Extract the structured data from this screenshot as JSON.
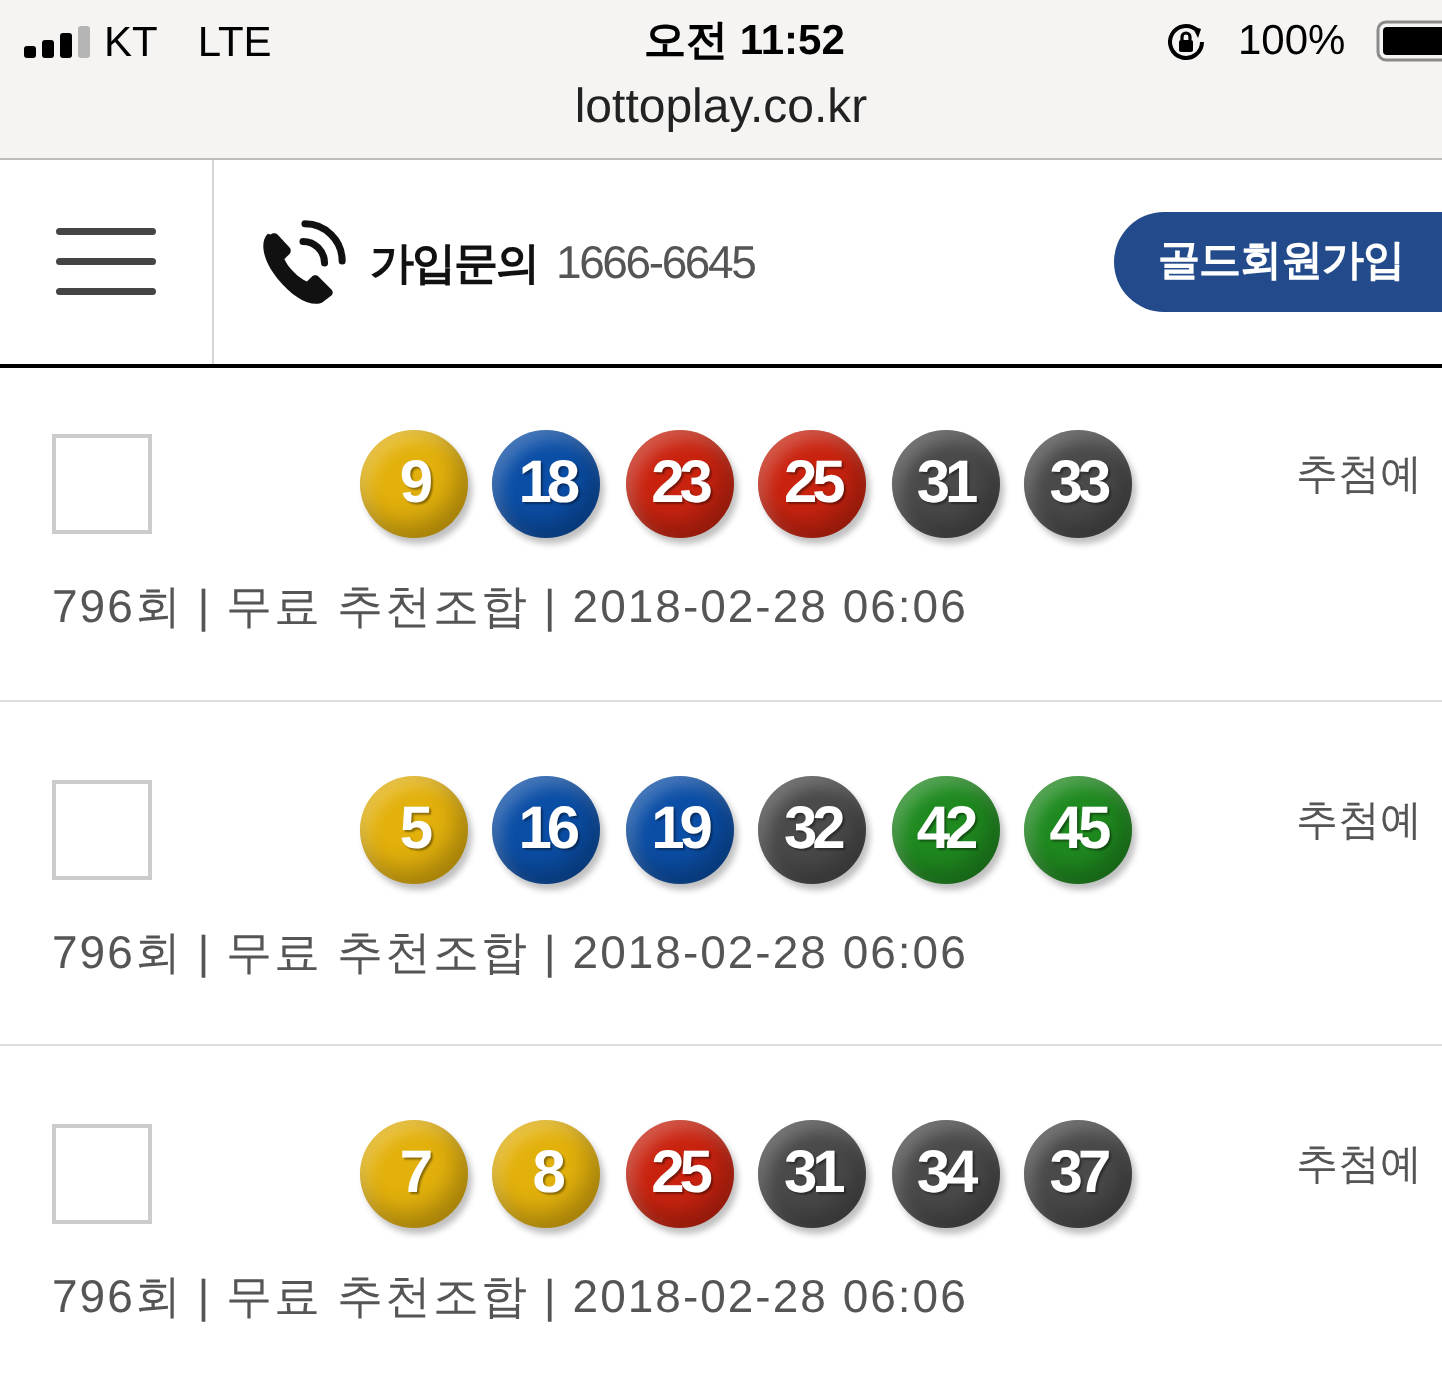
{
  "status_bar": {
    "carrier": "KT",
    "network": "LTE",
    "time": "오전 11:52",
    "battery": "100%"
  },
  "address_bar": {
    "url": "lottoplay.co.kr"
  },
  "header": {
    "contact_label": "가입문의",
    "contact_phone": "1666-6645",
    "join_button": "골드회원가입"
  },
  "entries": [
    {
      "checked": false,
      "balls": [
        {
          "number": "9",
          "color": "#e3b10c"
        },
        {
          "number": "18",
          "color": "#0b4ea6"
        },
        {
          "number": "23",
          "color": "#c9230f"
        },
        {
          "number": "25",
          "color": "#c9230f"
        },
        {
          "number": "31",
          "color": "#4a4a4a"
        },
        {
          "number": "33",
          "color": "#4a4a4a"
        }
      ],
      "status": "추첨예",
      "meta": "796회 | 무료 추천조합 | 2018-02-28 06:06"
    },
    {
      "checked": false,
      "balls": [
        {
          "number": "5",
          "color": "#e3b10c"
        },
        {
          "number": "16",
          "color": "#0b4ea6"
        },
        {
          "number": "19",
          "color": "#0b4ea6"
        },
        {
          "number": "32",
          "color": "#4a4a4a"
        },
        {
          "number": "42",
          "color": "#1f8a1f"
        },
        {
          "number": "45",
          "color": "#1f8a1f"
        }
      ],
      "status": "추첨예",
      "meta": "796회 | 무료 추천조합 | 2018-02-28 06:06"
    },
    {
      "checked": false,
      "balls": [
        {
          "number": "7",
          "color": "#e3b10c"
        },
        {
          "number": "8",
          "color": "#e3b10c"
        },
        {
          "number": "25",
          "color": "#c9230f"
        },
        {
          "number": "31",
          "color": "#4a4a4a"
        },
        {
          "number": "34",
          "color": "#4a4a4a"
        },
        {
          "number": "37",
          "color": "#4a4a4a"
        }
      ],
      "status": "추첨예",
      "meta": "796회 | 무료 추천조합 | 2018-02-28 06:06"
    }
  ]
}
